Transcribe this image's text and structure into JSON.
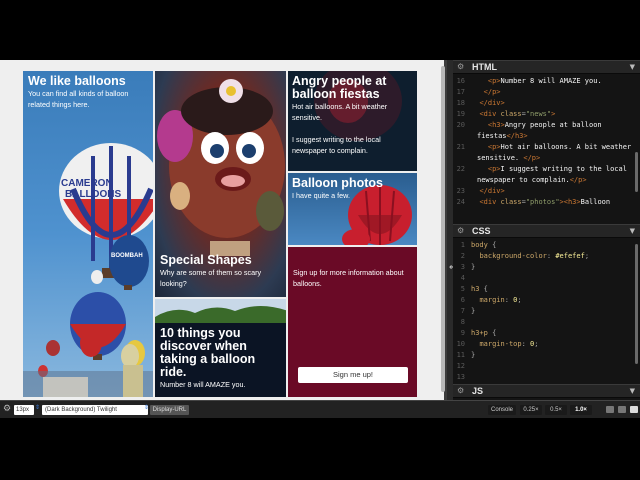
{
  "preview": {
    "intro": {
      "title": "We like balloons",
      "text": "You can find all kinds of balloon related things here."
    },
    "shapes": {
      "title": "Special Shapes",
      "text": "Why are some of them so scary looking?"
    },
    "angry": {
      "title": "Angry people at balloon fiestas",
      "text1": "Hot air balloons. A bit weather sensitive.",
      "text2": "I suggest writing to the local newspaper to complain."
    },
    "photos": {
      "title": "Balloon photos",
      "text": "I have quite a few."
    },
    "things": {
      "title": "10 things you discover when taking a balloon ride.",
      "text": "Number 8 will AMAZE you."
    },
    "signup": {
      "text": "Sign up for more information about balloons.",
      "button": "Sign me up!"
    },
    "balloon_texts": {
      "cameron": "CAMERON",
      "balloons": "BALLOONS",
      "boombah": "BOOMBAH"
    }
  },
  "editor": {
    "html": {
      "name": "HTML",
      "lines": [
        {
          "n": "16",
          "parts": [
            [
              "pun",
              "    "
            ],
            [
              "tag",
              "<p>"
            ],
            [
              "txt",
              "Number 8 will AMAZE you."
            ]
          ]
        },
        {
          "n": "17",
          "parts": [
            [
              "pun",
              "   "
            ],
            [
              "tag",
              "</p>"
            ]
          ]
        },
        {
          "n": "18",
          "parts": [
            [
              "pun",
              "  "
            ],
            [
              "tag",
              "</div>"
            ]
          ]
        },
        {
          "n": "19",
          "parts": [
            [
              "pun",
              "  "
            ],
            [
              "tag",
              "<div "
            ],
            [
              "attr",
              "class"
            ],
            [
              "pun",
              "="
            ],
            [
              "str",
              "\"news\""
            ],
            [
              "tag",
              ">"
            ]
          ]
        },
        {
          "n": "20",
          "wrap": true,
          "parts": [
            [
              "pun",
              "    "
            ],
            [
              "tag",
              "<h3>"
            ],
            [
              "txt",
              "Angry people at balloon fiestas"
            ],
            [
              "tag",
              "</h3>"
            ]
          ]
        },
        {
          "n": "21",
          "wrap": true,
          "parts": [
            [
              "pun",
              "    "
            ],
            [
              "tag",
              "<p>"
            ],
            [
              "txt",
              "Hot air balloons. A bit weather sensitive. "
            ],
            [
              "tag",
              "</p>"
            ]
          ]
        },
        {
          "n": "22",
          "wrap": true,
          "parts": [
            [
              "pun",
              "    "
            ],
            [
              "tag",
              "<p>"
            ],
            [
              "txt",
              "I suggest writing to the local newspaper to complain."
            ],
            [
              "tag",
              "</p>"
            ]
          ]
        },
        {
          "n": "23",
          "parts": [
            [
              "pun",
              "  "
            ],
            [
              "tag",
              "</div>"
            ]
          ]
        },
        {
          "n": "24",
          "parts": [
            [
              "pun",
              "  "
            ],
            [
              "tag",
              "<div "
            ],
            [
              "attr",
              "class"
            ],
            [
              "pun",
              "="
            ],
            [
              "str",
              "\"photos\""
            ],
            [
              "tag",
              ">"
            ],
            [
              "tag",
              "<h3>"
            ],
            [
              "txt",
              "Balloon"
            ]
          ]
        }
      ]
    },
    "css": {
      "name": "CSS",
      "lines": [
        {
          "n": "1",
          "parts": [
            [
              "sel",
              "body"
            ],
            [
              "pun",
              " {"
            ]
          ]
        },
        {
          "n": "2",
          "parts": [
            [
              "pun",
              "  "
            ],
            [
              "prop",
              "background-color"
            ],
            [
              "pun",
              ": "
            ],
            [
              "val",
              "#efefef"
            ],
            [
              "pun",
              ";"
            ]
          ]
        },
        {
          "n": "3",
          "parts": [
            [
              "pun",
              "}"
            ]
          ]
        },
        {
          "n": "4",
          "parts": []
        },
        {
          "n": "5",
          "parts": [
            [
              "sel",
              "h3"
            ],
            [
              "pun",
              " {"
            ]
          ]
        },
        {
          "n": "6",
          "parts": [
            [
              "pun",
              "  "
            ],
            [
              "prop",
              "margin"
            ],
            [
              "pun",
              ": "
            ],
            [
              "val",
              "0"
            ],
            [
              "pun",
              ";"
            ]
          ]
        },
        {
          "n": "7",
          "parts": [
            [
              "pun",
              "}"
            ]
          ]
        },
        {
          "n": "8",
          "parts": []
        },
        {
          "n": "9",
          "parts": [
            [
              "sel",
              "h3+p"
            ],
            [
              "pun",
              " {"
            ]
          ]
        },
        {
          "n": "10",
          "parts": [
            [
              "pun",
              "  "
            ],
            [
              "prop",
              "margin-top"
            ],
            [
              "pun",
              ": "
            ],
            [
              "val",
              "0"
            ],
            [
              "pun",
              ";"
            ]
          ]
        },
        {
          "n": "11",
          "parts": [
            [
              "pun",
              "}"
            ]
          ]
        },
        {
          "n": "12",
          "parts": []
        },
        {
          "n": "13",
          "parts": []
        }
      ]
    },
    "js": {
      "name": "JS"
    }
  },
  "bottombar": {
    "font_size": "13px",
    "theme": "(Dark Background) Twilight",
    "display_url": "Display-URL",
    "console": "Console",
    "zoom": [
      "0.25×",
      "0.5×",
      "1.0×"
    ],
    "zoom_selected": "1.0×"
  },
  "colors": {
    "signup_bg": "#6a0a26",
    "page_bg": "#efefef",
    "editor_bg": "#141414"
  }
}
